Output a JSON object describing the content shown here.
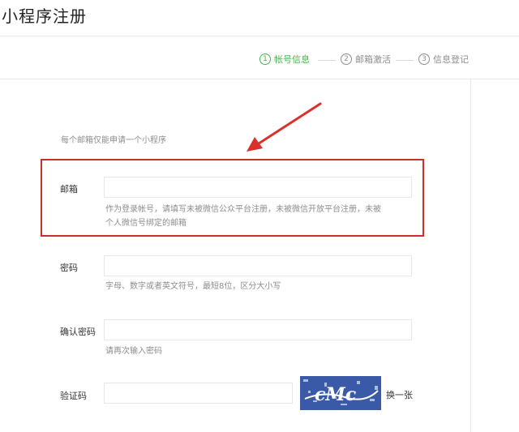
{
  "page": {
    "title": "小程序注册"
  },
  "steps": [
    {
      "num": "1",
      "label": "帐号信息",
      "active": true
    },
    {
      "num": "2",
      "label": "邮箱激活",
      "active": false
    },
    {
      "num": "3",
      "label": "信息登记",
      "active": false
    }
  ],
  "form": {
    "top_hint": "每个邮箱仅能申请一个小程序",
    "email": {
      "label": "邮箱",
      "value": "",
      "help_line1": "作为登录帐号，请填写未被微信公众平台注册，未被微信开放平台注册，未被",
      "help_line2": "个人微信号绑定的邮箱"
    },
    "password": {
      "label": "密码",
      "value": "",
      "help": "字母、数字或者英文符号，最短8位，区分大小写"
    },
    "confirm_password": {
      "label": "确认密码",
      "value": "",
      "help": "请再次输入密码"
    },
    "captcha": {
      "label": "验证码",
      "value": "",
      "image_text": "cMc",
      "swap_label": "换一张"
    }
  },
  "colors": {
    "active_step": "#44b549",
    "highlight": "#c9302c",
    "captcha_bg": "#3a5aa8"
  }
}
